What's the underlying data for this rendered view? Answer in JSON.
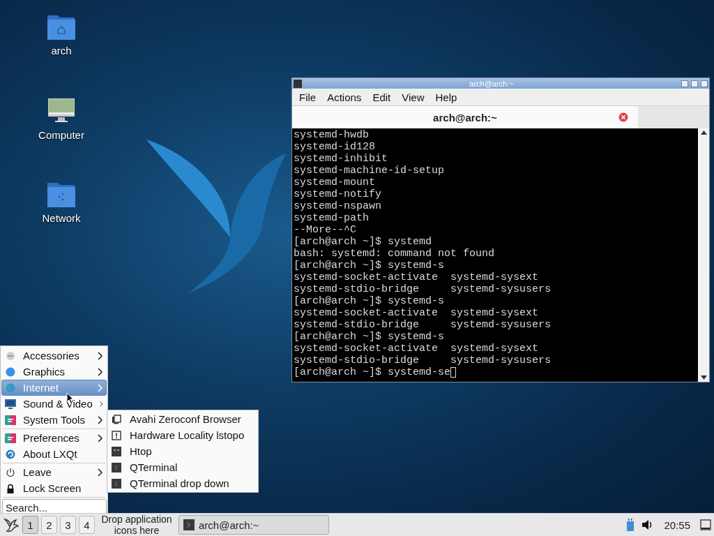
{
  "desktop_icons": [
    {
      "label": "arch"
    },
    {
      "label": "Computer"
    },
    {
      "label": "Network"
    }
  ],
  "terminal_window": {
    "title": "arch@arch:~",
    "menu": [
      "File",
      "Actions",
      "Edit",
      "View",
      "Help"
    ],
    "tabs": [
      {
        "label": "arch@arch:~",
        "selected": true
      }
    ],
    "lines": [
      "systemd-hwdb",
      "systemd-id128",
      "systemd-inhibit",
      "systemd-machine-id-setup",
      "systemd-mount",
      "systemd-notify",
      "systemd-nspawn",
      "systemd-path",
      "--More--^C",
      "[arch@arch ~]$ systemd",
      "bash: systemd: command not found",
      "[arch@arch ~]$ systemd-s",
      "systemd-socket-activate  systemd-sysext",
      "systemd-stdio-bridge     systemd-sysusers",
      "[arch@arch ~]$ systemd-s",
      "systemd-socket-activate  systemd-sysext",
      "systemd-stdio-bridge     systemd-sysusers",
      "[arch@arch ~]$ systemd-s",
      "systemd-socket-activate  systemd-sysext",
      "systemd-stdio-bridge     systemd-sysusers",
      "[arch@arch ~]$ systemd-se"
    ]
  },
  "app_menu": {
    "groups": [
      [
        {
          "label": "Accessories",
          "submenu": true,
          "selected": false
        },
        {
          "label": "Graphics",
          "submenu": true,
          "selected": false
        },
        {
          "label": "Internet",
          "submenu": true,
          "selected": true
        },
        {
          "label": "Sound & Video",
          "submenu": true,
          "selected": false
        },
        {
          "label": "System Tools",
          "submenu": true,
          "selected": false
        }
      ],
      [
        {
          "label": "Preferences",
          "submenu": true,
          "selected": false
        },
        {
          "label": "About LXQt",
          "submenu": false,
          "selected": false
        }
      ],
      [
        {
          "label": "Leave",
          "submenu": true,
          "selected": false
        },
        {
          "label": "Lock Screen",
          "submenu": false,
          "selected": false
        }
      ]
    ],
    "search": {
      "placeholder": "Search..."
    }
  },
  "submenu": {
    "items": [
      {
        "label": "Avahi Zeroconf Browser"
      },
      {
        "label": "Hardware Locality lstopo"
      },
      {
        "label": "Htop"
      },
      {
        "label": "QTerminal"
      },
      {
        "label": "QTerminal drop down"
      }
    ]
  },
  "taskbar": {
    "desktops": [
      {
        "label": "1",
        "selected": true
      },
      {
        "label": "2",
        "selected": false
      },
      {
        "label": "3",
        "selected": false
      },
      {
        "label": "4",
        "selected": false
      }
    ],
    "quicklaunch_hint": "Drop application icons here",
    "tasks": [
      {
        "label": "arch@arch:~"
      }
    ],
    "clock": "20:55"
  }
}
